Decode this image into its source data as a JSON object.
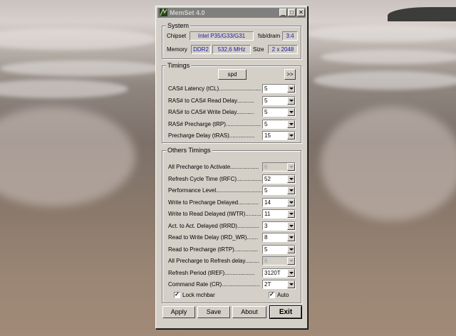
{
  "window": {
    "title": "MemSet 4.0",
    "controls": {
      "minimize": "_",
      "maximize": "□",
      "close": "✕"
    }
  },
  "system": {
    "label": "System",
    "chipset_label": "Chipset",
    "chipset_value": "Intel P35/G33/G31",
    "fsb_label": "fsb/dram",
    "fsb_value": "3:4",
    "memory_label": "Memory",
    "memory_type": "DDR2",
    "memory_freq": "532,6 MHz",
    "size_label": "Size",
    "size_value": "2 x 2048"
  },
  "timings": {
    "label": "Timings",
    "spd_button": "spd",
    "more_button": ">>",
    "rows": [
      {
        "label": "CAS# Latency (tCL)...........................",
        "value": "5"
      },
      {
        "label": "RAS# to CAS# Read Delay...........",
        "value": "5"
      },
      {
        "label": "RAS# to CAS# Write Delay...........",
        "value": "5"
      },
      {
        "label": "RAS# Precharge (tRP)......................",
        "value": "5"
      },
      {
        "label": "Precharge Delay  (tRAS)................",
        "value": "15"
      }
    ]
  },
  "others": {
    "label": "Others Timings",
    "rows": [
      {
        "label": "All Precharge to Activate..................",
        "value": "6",
        "disabled": true
      },
      {
        "label": "Refresh Cycle Time (tRFC)................",
        "value": "52",
        "disabled": false
      },
      {
        "label": "Performance Level.............................",
        "value": "5",
        "disabled": false
      },
      {
        "label": "Write to Precharge Delayed.............",
        "value": "14",
        "disabled": false
      },
      {
        "label": "Write to Read Delayed (tWTR)..........",
        "value": "11",
        "disabled": false
      },
      {
        "label": "Act. to Act. Delayed (tRRD)..............",
        "value": "3",
        "disabled": false
      },
      {
        "label": "Read to Write Delay (tRD_WR).......",
        "value": "8",
        "disabled": false
      },
      {
        "label": "Read to Precharge (tRTP)...............",
        "value": "5",
        "disabled": false
      },
      {
        "label": "All Precharge to Refresh delay.........",
        "value": "6",
        "disabled": true
      },
      {
        "label": "Refresh Period (tREF)...................",
        "value": "3120T",
        "disabled": false
      },
      {
        "label": "Command Rate (CR)........................",
        "value": "2T",
        "disabled": false
      }
    ],
    "lock_label": "Lock mchbar",
    "lock_checked": true,
    "auto_label": "Auto",
    "auto_checked": true
  },
  "buttons": {
    "apply": "Apply",
    "save": "Save",
    "about": "About",
    "exit": "Exit"
  }
}
